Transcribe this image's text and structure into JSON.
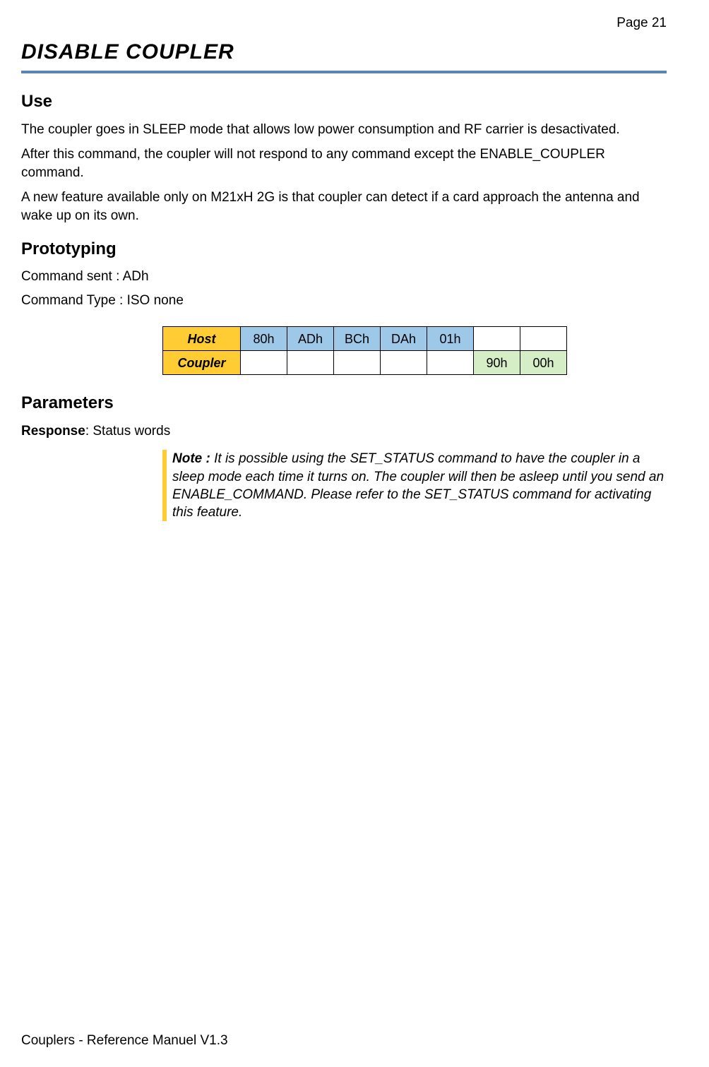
{
  "page_number": "Page 21",
  "title": "DISABLE COUPLER",
  "sections": {
    "use": {
      "heading": "Use",
      "paras": [
        "The coupler goes in SLEEP mode that allows low power consumption and RF carrier is desactivated.",
        "After this command, the coupler will not respond to any command except the ENABLE_COUPLER command.",
        "A new feature available only on M21xH 2G is that coupler can detect if a card approach the antenna and wake up on its own."
      ]
    },
    "prototyping": {
      "heading": "Prototyping",
      "command_sent": "Command sent : ADh",
      "command_type": "Command Type : ISO none",
      "table": {
        "host_label": "Host",
        "coupler_label": "Coupler",
        "host_bytes": [
          "80h",
          "ADh",
          "BCh",
          "DAh",
          "01h"
        ],
        "coupler_bytes": [
          "90h",
          "00h"
        ]
      }
    },
    "parameters": {
      "heading": "Parameters",
      "response_label": "Response",
      "response_text": ": Status words",
      "note_label": "Note :",
      "note_text": " It is possible using the SET_STATUS command to have the coupler in a sleep mode each time it turns on. The coupler will then be asleep until you send an ENABLE_COMMAND. Please refer to the SET_STATUS command for activating this feature."
    }
  },
  "footer": "Couplers - Reference Manuel V1.3"
}
